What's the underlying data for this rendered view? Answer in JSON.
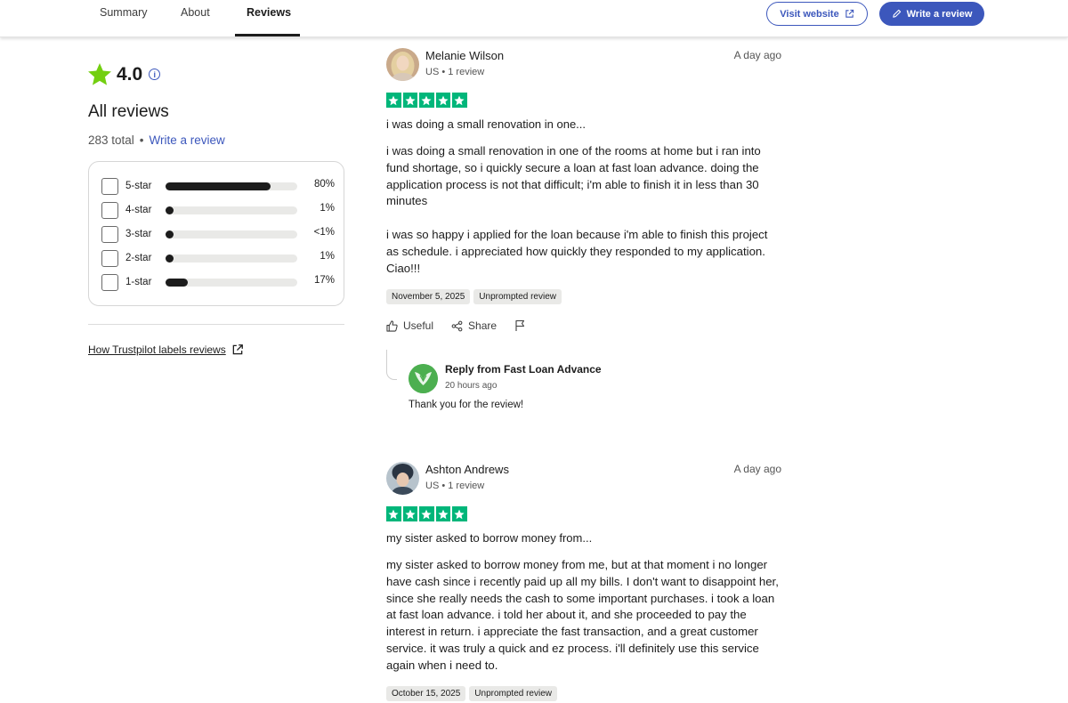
{
  "nav": {
    "tabs": [
      {
        "label": "Summary"
      },
      {
        "label": "About"
      },
      {
        "label": "Reviews",
        "active": true
      }
    ],
    "visit_website": "Visit website",
    "write_review": "Write a review"
  },
  "summary": {
    "rating": "4.0",
    "heading": "All reviews",
    "total": "283 total",
    "separator": "•",
    "write_review_link": "Write a review",
    "distribution": [
      {
        "label": "5-star",
        "percent_text": "80%",
        "fill_fraction": 0.8
      },
      {
        "label": "4-star",
        "percent_text": "1%",
        "fill_fraction": 0.01
      },
      {
        "label": "3-star",
        "percent_text": "<1%",
        "fill_fraction": 0.005
      },
      {
        "label": "2-star",
        "percent_text": "1%",
        "fill_fraction": 0.01
      },
      {
        "label": "1-star",
        "percent_text": "17%",
        "fill_fraction": 0.17
      }
    ],
    "how_labels_link": "How Trustpilot labels reviews"
  },
  "reviews": [
    {
      "name": "Melanie Wilson",
      "meta": "US • 1 review",
      "date": "A day ago",
      "stars": 5,
      "title": "i was doing a small renovation in one...",
      "body": [
        "i was doing a small renovation in one of the rooms at home but i ran into fund shortage, so i quickly secure a loan at fast loan advance. doing the application process is not that difficult; i'm able to finish it in less than 30 minutes",
        "i was so happy i applied for the loan because i'm able to finish this project as schedule. i appreciated how quickly they responded to my application. Ciao!!!"
      ],
      "experience_date": "November 5, 2025",
      "tag": "Unprompted review",
      "actions": {
        "useful": "Useful",
        "share": "Share"
      },
      "reply": {
        "from": "Reply from Fast Loan Advance",
        "time": "20 hours ago",
        "text": "Thank you for the review!"
      }
    },
    {
      "name": "Ashton Andrews",
      "meta": "US • 1 review",
      "date": "A day ago",
      "stars": 5,
      "title": "my sister asked to borrow money from...",
      "body": [
        "my sister asked to borrow money from me, but at that moment i no longer have cash since i recently paid up all my bills. I don't want to disappoint her, since she really needs the cash to some important purchases. i took a loan at fast loan advance. i told her about it, and she proceeded to pay the interest in return. i appreciate the fast transaction, and a great customer service. it was truly a quick and ez process. i'll definitely use this service again when i need to."
      ],
      "experience_date": "October 15, 2025",
      "tag": "Unprompted review"
    }
  ],
  "colors": {
    "accent": "#3c57bc",
    "star_green": "#00b67a",
    "rating_star": "#73cf11",
    "text": "#1c1c1c",
    "tag_bg": "#e9e9e7"
  },
  "icons": [
    "info-icon",
    "external-link-icon",
    "pencil-icon",
    "star-icon",
    "thumbs-up-icon",
    "share-icon",
    "flag-icon"
  ]
}
